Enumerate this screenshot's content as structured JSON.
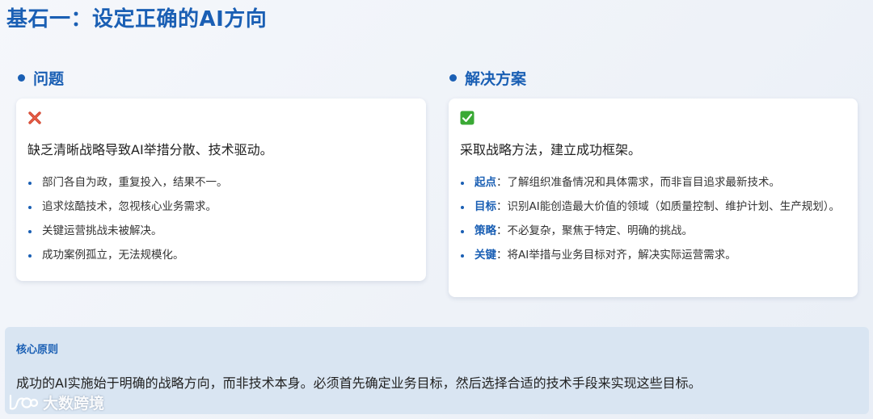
{
  "page": {
    "title": "基石一：设定正确的AI方向"
  },
  "problem": {
    "heading": "问题",
    "icon": "cross-mark-icon",
    "summary": "缺乏清晰战略导致AI举措分散、技术驱动。",
    "items": [
      "部门各自为政，重复投入，结果不一。",
      "追求炫酷技术，忽视核心业务需求。",
      "关键运营挑战未被解决。",
      "成功案例孤立，无法规模化。"
    ]
  },
  "solution": {
    "heading": "解决方案",
    "icon": "check-mark-icon",
    "summary": "采取战略方法，建立成功框架。",
    "items": [
      {
        "term": "起点",
        "text": "：了解组织准备情况和具体需求，而非盲目追求最新技术。"
      },
      {
        "term": "目标",
        "text": "：识别AI能创造最大价值的领域（如质量控制、维护计划、生产规划）。"
      },
      {
        "term": "策略",
        "text": "：不必复杂，聚焦于特定、明确的挑战。"
      },
      {
        "term": "关键",
        "text": "：将AI举措与业务目标对齐，解决实际运营需求。"
      }
    ]
  },
  "principle": {
    "label": "核心原则",
    "text": "成功的AI实施始于明确的战略方向，而非技术本身。必须首先确定业务目标，然后选择合适的技术手段来实现这些目标。"
  },
  "watermark": {
    "text": "大数跨境"
  },
  "colors": {
    "accent": "#1a5fb4",
    "cross": "#d1452f",
    "check": "#3aa935",
    "principle_bg": "#d9e5f2"
  }
}
